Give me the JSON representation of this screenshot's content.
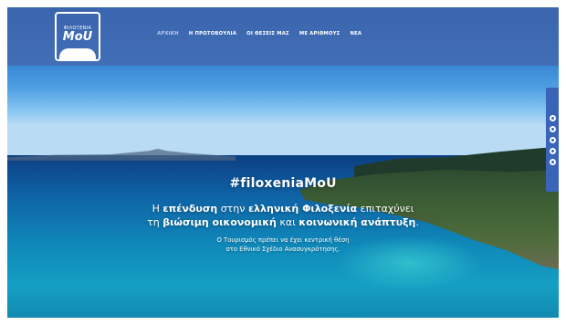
{
  "brand": {
    "logo_top": "ΦΙΛΟΞΕΝΙΑ",
    "logo_main": "MoU"
  },
  "nav": {
    "items": [
      {
        "label": "ΑΡΧΙΚΗ",
        "active": true
      },
      {
        "label": "Η ΠΡΩΤΟΒΟΥΛΙΑ",
        "active": false
      },
      {
        "label": "ΟΙ ΘΕΣΕΙΣ ΜΑΣ",
        "active": false
      },
      {
        "label": "ΜΕ ΑΡΙΘΜΟΥΣ",
        "active": false
      },
      {
        "label": "ΝΕΑ",
        "active": false
      }
    ]
  },
  "hero": {
    "title": "#filoxeniaMoU",
    "line1": {
      "p1": "Η ",
      "b1": "επένδυση",
      "p2": " στην ",
      "b2": "ελληνική Φιλοξενία",
      "p3": " επιταχύνει"
    },
    "line2": {
      "p1": "τη ",
      "b1": "βιώσιμη οικονομική",
      "p2": " και ",
      "b2": "κοινωνική ανάπτυξη",
      "p3": "."
    },
    "sub1": "Ο Τουρισμός πρέπει να έχει κεντρική θέση",
    "sub2": "στο Εθνικό Σχέδιο Ανασυγκρότησης."
  },
  "social": {
    "icons": [
      "facebook-icon",
      "instagram-icon",
      "twitter-icon",
      "youtube-icon",
      "linkedin-icon"
    ]
  },
  "colors": {
    "header_bg": "#4669af",
    "social_bg": "#3a64b8",
    "nav_active": "#b8c8e8"
  }
}
